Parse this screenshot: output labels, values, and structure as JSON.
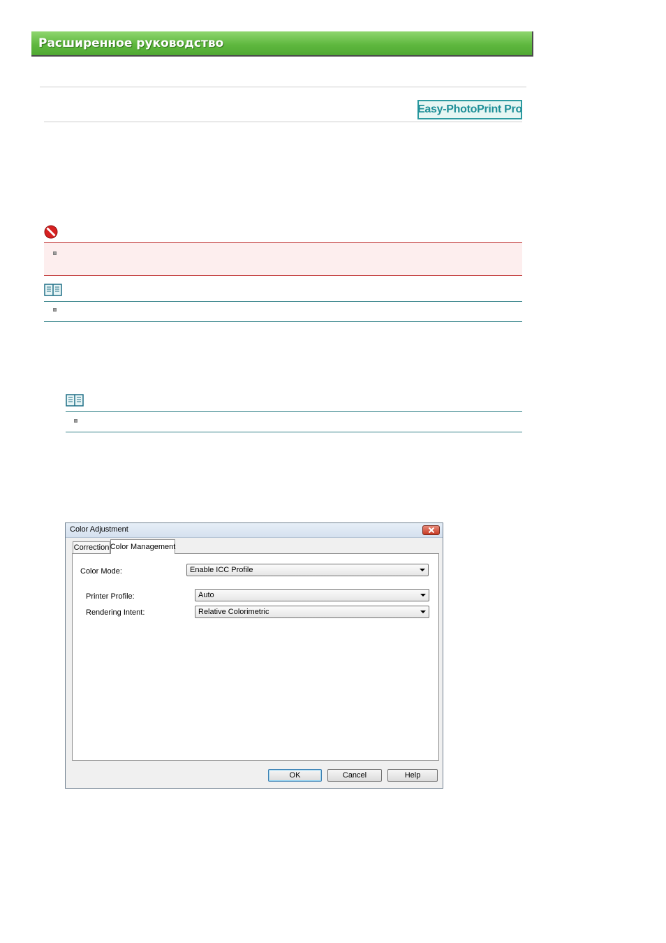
{
  "header": {
    "title": "Расширенное руководство"
  },
  "badge": {
    "label": "Easy-PhotoPrint Pro"
  },
  "icons": {
    "important": "prohibited-icon",
    "note": "open-book-icon",
    "bullet": "square-bullet-icon",
    "close": "close-icon",
    "dropdown": "chevron-down-icon"
  },
  "colors": {
    "banner": "#5fb83f",
    "badge": "#1f8f98",
    "important_border": "#c23b3b",
    "important_fill": "#fdeeee",
    "note_line": "#2f7f86"
  },
  "dialog": {
    "title": "Color Adjustment",
    "tabs": [
      {
        "label": "Correction"
      },
      {
        "label": "Color Management"
      }
    ],
    "fields": {
      "color_mode": {
        "label": "Color Mode:",
        "value": "Enable ICC Profile"
      },
      "printer_profile": {
        "label": "Printer Profile:",
        "value": "Auto"
      },
      "rendering_intent": {
        "label": "Rendering Intent:",
        "value": "Relative Colorimetric"
      }
    },
    "buttons": {
      "ok": "OK",
      "cancel": "Cancel",
      "help": "Help"
    }
  }
}
